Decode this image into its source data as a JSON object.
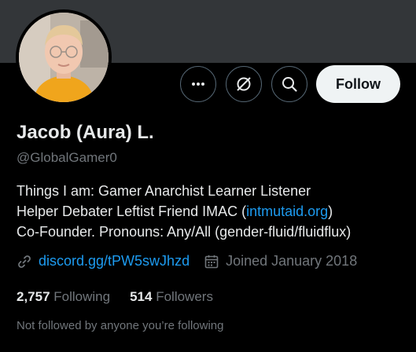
{
  "profile": {
    "name": "Jacob (Aura) L.",
    "handle": "@GlobalGamer0",
    "bio_line1": "Things I am: Gamer  Anarchist  Learner  Listener",
    "bio_line2_prefix": "Helper Debater  Leftist  Friend  IMAC (",
    "bio_line2_link": "intmutaid.org",
    "bio_line2_suffix": ")",
    "bio_line3": "Co-Founder. Pronouns: Any/All (gender-fluid/fluidflux)",
    "website": "discord.gg/tPW5swJhzd",
    "joined": "Joined January 2018"
  },
  "actions": {
    "more_icon": "more-icon",
    "grok_icon": "grok-icon",
    "search_icon": "search-icon",
    "follow_label": "Follow"
  },
  "stats": {
    "following_count": "2,757",
    "following_label": "Following",
    "followers_count": "514",
    "followers_label": "Followers"
  },
  "footer": {
    "not_followed": "Not followed by anyone you’re following"
  },
  "colors": {
    "background": "#000000",
    "banner": "#333639",
    "link": "#1d9bf0",
    "muted": "#71767b",
    "text": "#e7e9ea",
    "follow_bg": "#eff3f4"
  }
}
